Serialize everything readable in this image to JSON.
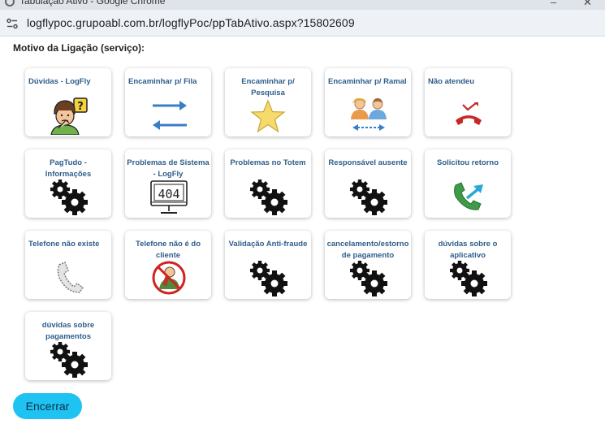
{
  "browser": {
    "window_title": "Tabulação Ativo - Google Chrome",
    "url": "logflypoc.grupoabl.com.br/logflyPoc/ppTabAtivo.aspx?15802609"
  },
  "section_title": "Motivo da Ligação (serviço):",
  "options": [
    {
      "label": "Dúvidas - LogFly",
      "icon": "thinking-person-icon"
    },
    {
      "label": "Encaminhar p/ Fila",
      "icon": "transfer-arrows-icon"
    },
    {
      "label": "Encaminhar p/ Pesquisa",
      "icon": "star-icon"
    },
    {
      "label": "Encaminhar p/ Ramal",
      "icon": "two-users-transfer-icon"
    },
    {
      "label": "Não atendeu",
      "icon": "missed-call-icon"
    },
    {
      "label": "PagTudo - Informações",
      "icon": "gears-icon"
    },
    {
      "label": "Problemas de Sistema - LogFly",
      "icon": "error-404-monitor-icon"
    },
    {
      "label": "Problemas no Totem",
      "icon": "gears-icon"
    },
    {
      "label": "Responsável ausente",
      "icon": "gears-icon"
    },
    {
      "label": "Solicitou retorno",
      "icon": "callback-phone-icon"
    },
    {
      "label": "Telefone não existe",
      "icon": "phone-outline-icon"
    },
    {
      "label": "Telefone não é do cliente",
      "icon": "no-person-phone-icon"
    },
    {
      "label": "Validação Anti-fraude",
      "icon": "gears-icon"
    },
    {
      "label": "cancelamento/estorno de pagamento",
      "icon": "gears-icon"
    },
    {
      "label": "dúvidas sobre o aplicativo",
      "icon": "gears-icon"
    },
    {
      "label": "dúvidas sobre pagamentos",
      "icon": "gears-icon"
    }
  ],
  "end_button_label": "Encerrar"
}
